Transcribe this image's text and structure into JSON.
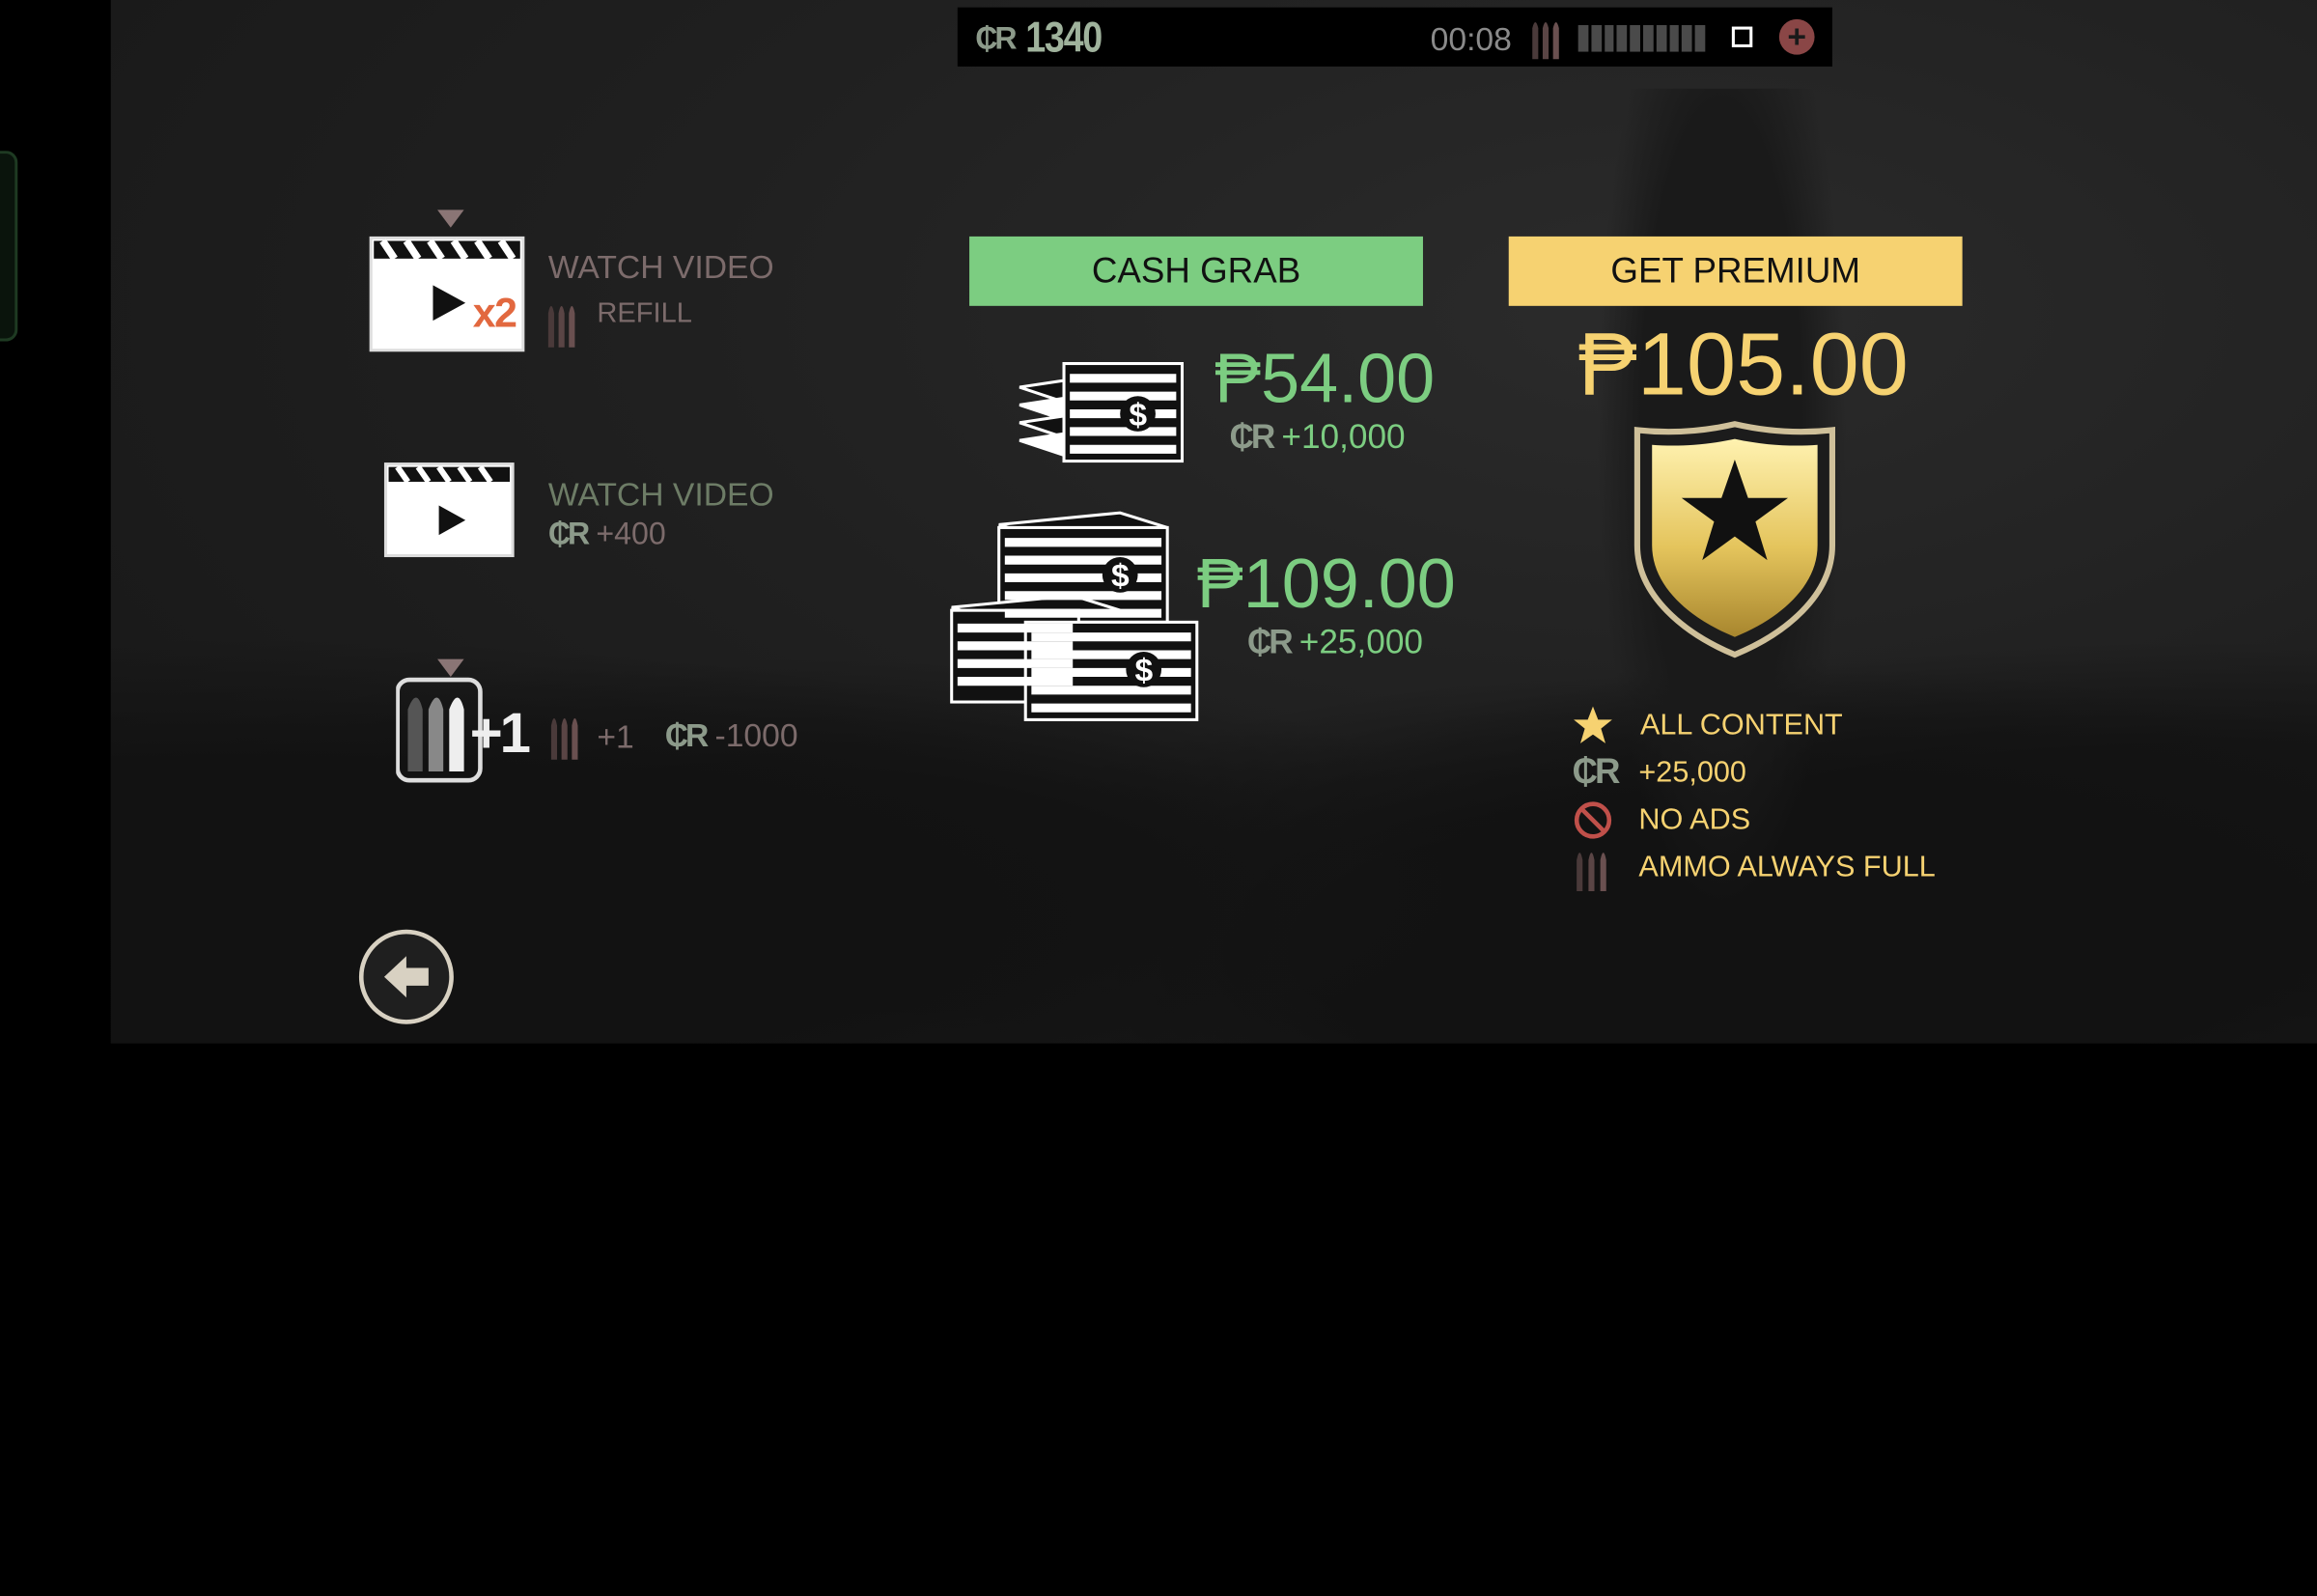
{
  "hud": {
    "currency_symbol": "₵R",
    "credits": "1340",
    "timer": "00:08",
    "icons": [
      "ammo-icon",
      "stop-icon",
      "plus-icon"
    ]
  },
  "offers": [
    {
      "title": "WATCH VIDEO",
      "multiplier": "x2",
      "sub_label": "REFILL",
      "icon": "video-x2-icon"
    },
    {
      "title": "WATCH VIDEO",
      "currency_symbol": "₵R",
      "sub_label": "+400",
      "icon": "video-icon"
    },
    {
      "badge": "+1",
      "ammo_amount": "+1",
      "currency_symbol": "₵R",
      "cost": "-1000",
      "icon": "ammo-plus-icon"
    }
  ],
  "cash_grab": {
    "label": "CASH GRAB",
    "packs": [
      {
        "price": "₱54.00",
        "currency_symbol": "₵R",
        "bonus": "+10,000"
      },
      {
        "price": "₱109.00",
        "currency_symbol": "₵R",
        "bonus": "+25,000"
      }
    ]
  },
  "premium": {
    "label": "GET PREMIUM",
    "price": "₱105.00",
    "perks": [
      {
        "icon": "star-icon",
        "label": "ALL CONTENT"
      },
      {
        "icon": "credits-icon",
        "currency_symbol": "₵R",
        "label": "+25,000"
      },
      {
        "icon": "no-ads-icon",
        "label": "NO ADS"
      },
      {
        "icon": "ammo-icon",
        "label": "AMMO ALWAYS FULL"
      }
    ]
  },
  "colors": {
    "cash_green": "#7ccd81",
    "premium_gold": "#f6d271",
    "muted_red": "#7c6b6b",
    "muted_green": "#6d7c66"
  }
}
